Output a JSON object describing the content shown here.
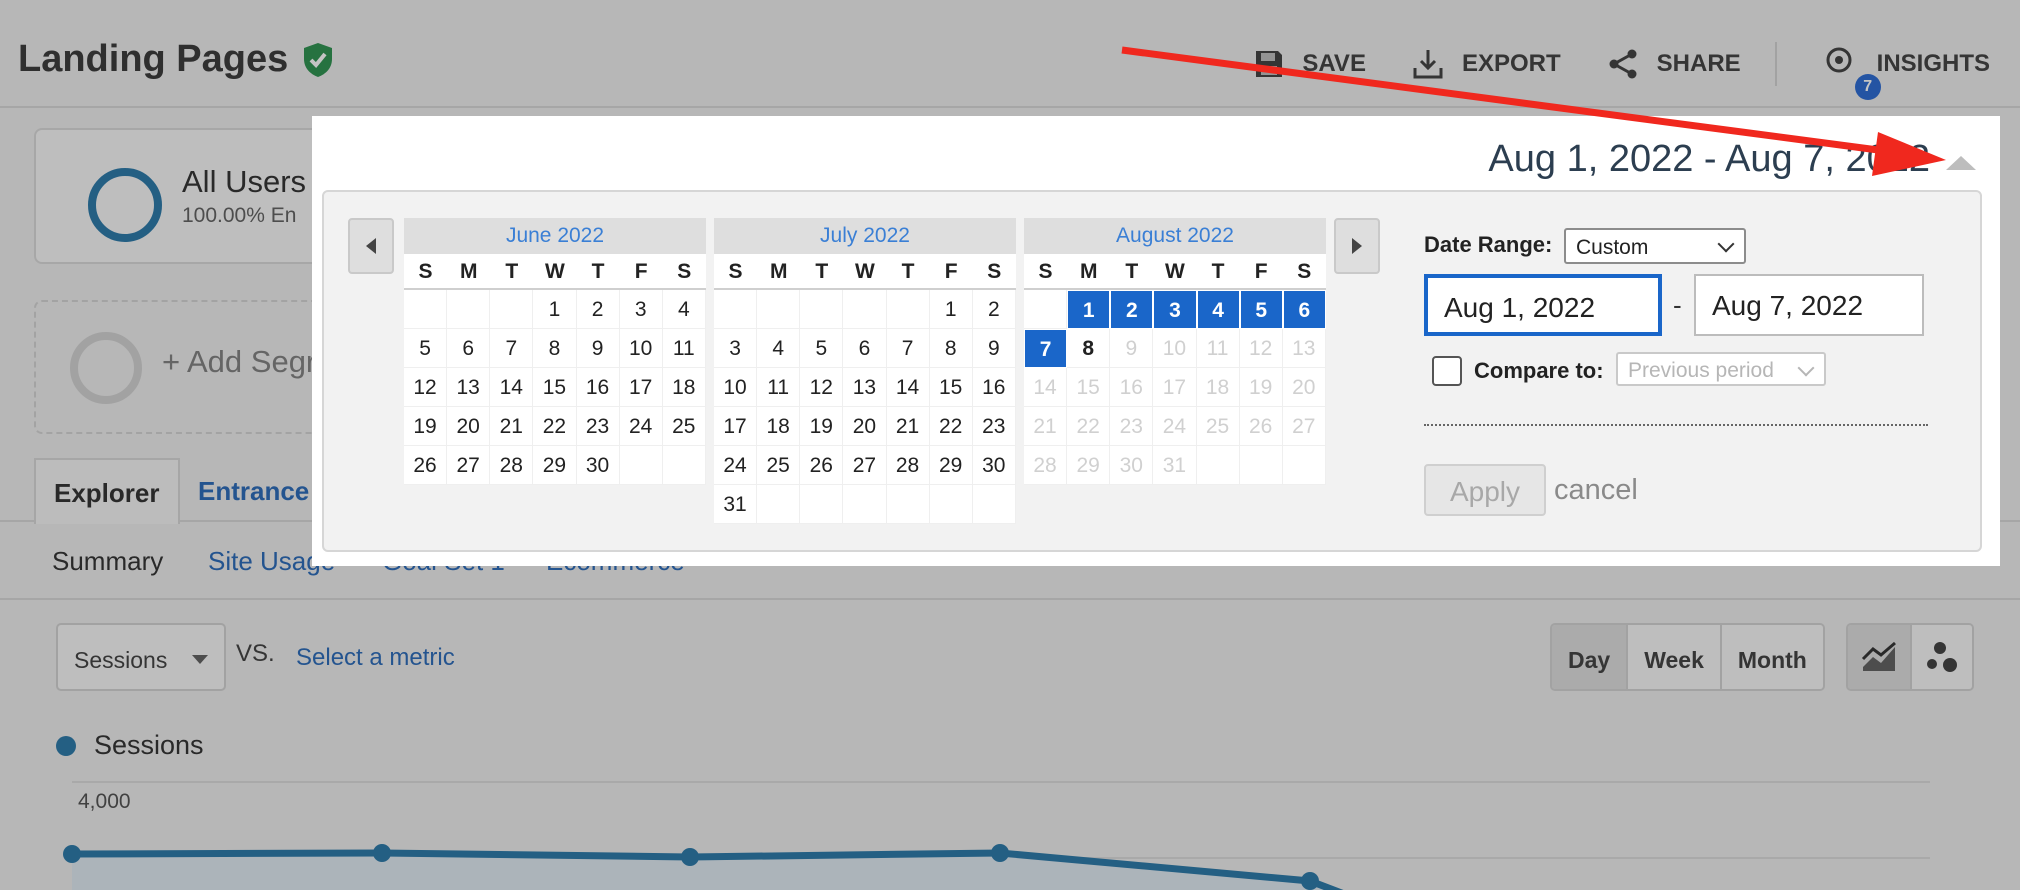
{
  "header": {
    "title": "Landing Pages",
    "actions": [
      {
        "label": "SAVE",
        "icon": "save-icon"
      },
      {
        "label": "EXPORT",
        "icon": "export-icon"
      },
      {
        "label": "SHARE",
        "icon": "share-icon"
      },
      {
        "label": "INSIGHTS",
        "icon": "insights-icon",
        "badge": "7"
      }
    ]
  },
  "segment": {
    "title": "All Users",
    "subtitle": "100.00% En",
    "add_label": "+ Add Segr"
  },
  "tabs": [
    "Explorer",
    "Entrance"
  ],
  "subtabs": [
    "Summary",
    "Site Usage",
    "Goal Set 1",
    "Ecommerce"
  ],
  "metric": {
    "selected": "Sessions",
    "vs": "VS.",
    "select_prompt": "Select a metric"
  },
  "granularity": [
    "Day",
    "Week",
    "Month"
  ],
  "chart_preview": {
    "legend": "Sessions",
    "ytick": "4,000",
    "color": "#1b6fa3"
  },
  "picker": {
    "range_title": "Aug 1, 2022 - Aug 7, 2022",
    "weekdays": [
      "S",
      "M",
      "T",
      "W",
      "T",
      "F",
      "S"
    ],
    "months": [
      {
        "name": "June 2022",
        "first_weekday": 3,
        "days": 30
      },
      {
        "name": "July 2022",
        "first_weekday": 5,
        "days": 31
      },
      {
        "name": "August 2022",
        "first_weekday": 1,
        "days": 31,
        "selected": [
          1,
          2,
          3,
          4,
          5,
          6,
          7
        ],
        "today": 8
      }
    ],
    "date_range_label": "Date Range:",
    "date_range_value": "Custom",
    "start_date": "Aug 1, 2022",
    "end_date": "Aug 7, 2022",
    "separator": "-",
    "compare_label": "Compare to:",
    "compare_value": "Previous period",
    "apply_label": "Apply",
    "cancel_label": "cancel"
  },
  "colors": {
    "accent": "#1a66c9",
    "annotation_arrow": "#f0281e"
  }
}
